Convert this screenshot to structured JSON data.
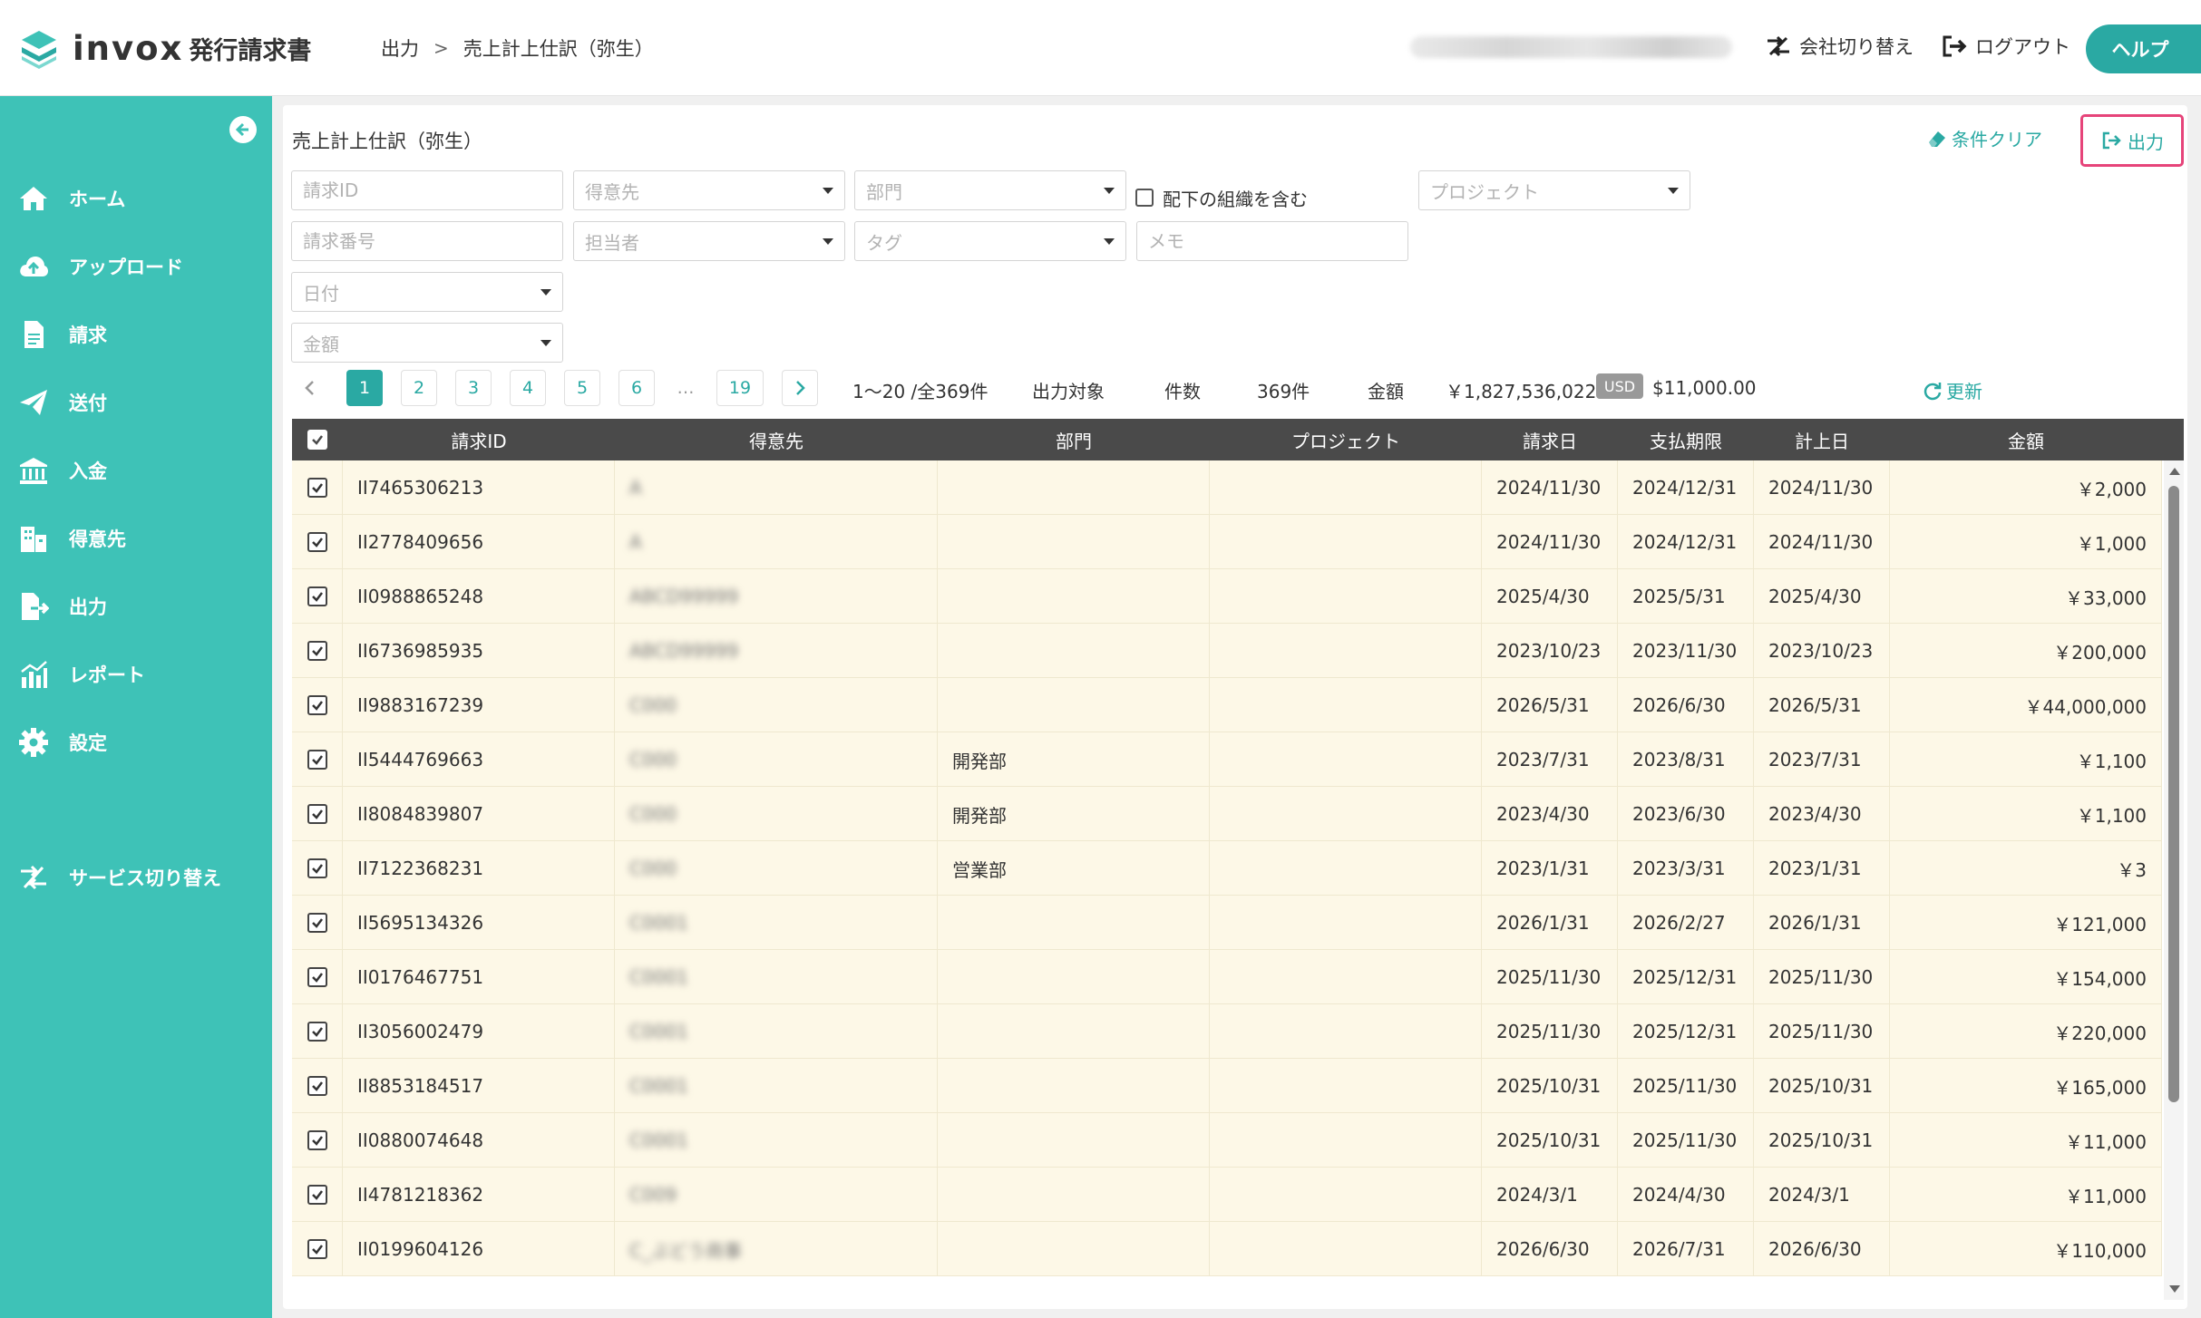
{
  "header": {
    "logo_word": "invox",
    "logo_sub": "発行請求書",
    "breadcrumb": [
      "出力",
      "売上計上仕訳（弥生）"
    ],
    "switch_company": "会社切り替え",
    "logout": "ログアウト",
    "help": "ヘルプ"
  },
  "sidebar": {
    "items": [
      {
        "label": "ホーム",
        "icon": "home-icon"
      },
      {
        "label": "アップロード",
        "icon": "cloud-upload-icon"
      },
      {
        "label": "請求",
        "icon": "document-icon"
      },
      {
        "label": "送付",
        "icon": "paper-plane-icon"
      },
      {
        "label": "入金",
        "icon": "bank-icon"
      },
      {
        "label": "得意先",
        "icon": "building-icon"
      },
      {
        "label": "出力",
        "icon": "file-export-icon"
      },
      {
        "label": "レポート",
        "icon": "chart-icon"
      },
      {
        "label": "設定",
        "icon": "gear-icon"
      }
    ],
    "service_switch": "サービス切り替え"
  },
  "panel": {
    "title": "売上計上仕訳（弥生）",
    "clear": "条件クリア",
    "export": "出力"
  },
  "filters": {
    "invoice_id": "請求ID",
    "customer": "得意先",
    "department": "部門",
    "include_sub": "配下の組織を含む",
    "project": "プロジェクト",
    "invoice_number": "請求番号",
    "assignee": "担当者",
    "tag": "タグ",
    "memo": "メモ",
    "date": "日付",
    "amount": "金額"
  },
  "pagination": {
    "pages": [
      "1",
      "2",
      "3",
      "4",
      "5",
      "6",
      "…",
      "19"
    ],
    "range": "1〜20 /全369件"
  },
  "stats": {
    "target_label": "出力対象",
    "count_label": "件数",
    "count_value": "369件",
    "amount_label": "金額",
    "amount_value": "￥1,827,536,022",
    "usd_badge": "USD",
    "usd_value": "$11,000.00",
    "refresh": "更新"
  },
  "table": {
    "columns": [
      "請求ID",
      "得意先",
      "部門",
      "プロジェクト",
      "請求日",
      "支払期限",
      "計上日",
      "金額"
    ],
    "rows": [
      {
        "id": "II7465306213",
        "customer": "A",
        "dept": "",
        "project": "",
        "invoice_date": "2024/11/30",
        "due": "2024/12/31",
        "posted": "2024/11/30",
        "amount": "￥2,000"
      },
      {
        "id": "II2778409656",
        "customer": "A",
        "dept": "",
        "project": "",
        "invoice_date": "2024/11/30",
        "due": "2024/12/31",
        "posted": "2024/11/30",
        "amount": "￥1,000"
      },
      {
        "id": "II0988865248",
        "customer": "ABCD99999",
        "dept": "",
        "project": "",
        "invoice_date": "2025/4/30",
        "due": "2025/5/31",
        "posted": "2025/4/30",
        "amount": "￥33,000"
      },
      {
        "id": "II6736985935",
        "customer": "ABCD99999",
        "dept": "",
        "project": "",
        "invoice_date": "2023/10/23",
        "due": "2023/11/30",
        "posted": "2023/10/23",
        "amount": "￥200,000"
      },
      {
        "id": "II9883167239",
        "customer": "C000",
        "dept": "",
        "project": "",
        "invoice_date": "2026/5/31",
        "due": "2026/6/30",
        "posted": "2026/5/31",
        "amount": "￥44,000,000"
      },
      {
        "id": "II5444769663",
        "customer": "C000",
        "dept": "開発部",
        "project": "",
        "invoice_date": "2023/7/31",
        "due": "2023/8/31",
        "posted": "2023/7/31",
        "amount": "￥1,100"
      },
      {
        "id": "II8084839807",
        "customer": "C000",
        "dept": "開発部",
        "project": "",
        "invoice_date": "2023/4/30",
        "due": "2023/6/30",
        "posted": "2023/4/30",
        "amount": "￥1,100"
      },
      {
        "id": "II7122368231",
        "customer": "C000",
        "dept": "営業部",
        "project": "",
        "invoice_date": "2023/1/31",
        "due": "2023/3/31",
        "posted": "2023/1/31",
        "amount": "￥3"
      },
      {
        "id": "II5695134326",
        "customer": "C0001",
        "dept": "",
        "project": "",
        "invoice_date": "2026/1/31",
        "due": "2026/2/27",
        "posted": "2026/1/31",
        "amount": "￥121,000"
      },
      {
        "id": "II0176467751",
        "customer": "C0001",
        "dept": "",
        "project": "",
        "invoice_date": "2025/11/30",
        "due": "2025/12/31",
        "posted": "2025/11/30",
        "amount": "￥154,000"
      },
      {
        "id": "II3056002479",
        "customer": "C0001",
        "dept": "",
        "project": "",
        "invoice_date": "2025/11/30",
        "due": "2025/12/31",
        "posted": "2025/11/30",
        "amount": "￥220,000"
      },
      {
        "id": "II8853184517",
        "customer": "C0001",
        "dept": "",
        "project": "",
        "invoice_date": "2025/10/31",
        "due": "2025/11/30",
        "posted": "2025/10/31",
        "amount": "￥165,000"
      },
      {
        "id": "II0880074648",
        "customer": "C0001",
        "dept": "",
        "project": "",
        "invoice_date": "2025/10/31",
        "due": "2025/11/30",
        "posted": "2025/10/31",
        "amount": "￥11,000"
      },
      {
        "id": "II4781218362",
        "customer": "C009",
        "dept": "",
        "project": "",
        "invoice_date": "2024/3/1",
        "due": "2024/4/30",
        "posted": "2024/3/1",
        "amount": "￥11,000"
      },
      {
        "id": "II0199604126",
        "customer": "C_ぶどう商事",
        "dept": "",
        "project": "",
        "invoice_date": "2026/6/30",
        "due": "2026/7/31",
        "posted": "2026/6/30",
        "amount": "￥110,000"
      }
    ]
  },
  "colors": {
    "accent": "#3ec2b7",
    "accent_dark": "#2aa9a3",
    "highlight_border": "#e6447a",
    "row_bg": "#fdf8e7",
    "table_header": "#4a4a4a"
  }
}
